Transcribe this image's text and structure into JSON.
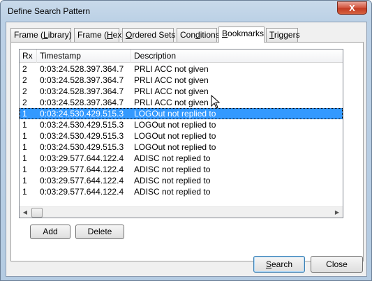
{
  "window": {
    "title": "Define Search Pattern",
    "close_glyph": "X"
  },
  "tabs": [
    {
      "pre": "Frame (",
      "ul": "L",
      "post": "ibrary)"
    },
    {
      "pre": "Frame (",
      "ul": "H",
      "post": "ex)"
    },
    {
      "pre": "",
      "ul": "O",
      "post": "rdered Sets"
    },
    {
      "pre": "Con",
      "ul": "d",
      "post": "itions"
    },
    {
      "pre": "",
      "ul": "B",
      "post": "ookmarks"
    },
    {
      "pre": "",
      "ul": "T",
      "post": "riggers"
    }
  ],
  "active_tab": 4,
  "list": {
    "columns": [
      "Rx",
      "Timestamp",
      "Description"
    ],
    "rows": [
      {
        "rx": "2",
        "timestamp": "0:03:24.528.397.364.7",
        "description": "PRLI ACC not given"
      },
      {
        "rx": "2",
        "timestamp": "0:03:24.528.397.364.7",
        "description": "PRLI ACC not given"
      },
      {
        "rx": "2",
        "timestamp": "0:03:24.528.397.364.7",
        "description": "PRLI ACC not given"
      },
      {
        "rx": "2",
        "timestamp": "0:03:24.528.397.364.7",
        "description": "PRLI ACC not given"
      },
      {
        "rx": "1",
        "timestamp": "0:03:24.530.429.515.3",
        "description": "LOGOut not replied to",
        "selected": true
      },
      {
        "rx": "1",
        "timestamp": "0:03:24.530.429.515.3",
        "description": "LOGOut not replied to"
      },
      {
        "rx": "1",
        "timestamp": "0:03:24.530.429.515.3",
        "description": "LOGOut not replied to"
      },
      {
        "rx": "1",
        "timestamp": "0:03:24.530.429.515.3",
        "description": "LOGOut not replied to"
      },
      {
        "rx": "1",
        "timestamp": "0:03:29.577.644.122.4",
        "description": "ADISC not replied to"
      },
      {
        "rx": "1",
        "timestamp": "0:03:29.577.644.122.4",
        "description": "ADISC not replied to"
      },
      {
        "rx": "1",
        "timestamp": "0:03:29.577.644.122.4",
        "description": "ADISC not replied to"
      },
      {
        "rx": "1",
        "timestamp": "0:03:29.577.644.122.4",
        "description": "ADISC not replied to"
      }
    ]
  },
  "buttons": {
    "add": "Add",
    "delete": "Delete",
    "search_ul": "S",
    "search_rest": "earch",
    "close": "Close"
  },
  "colors": {
    "selection": "#3399ff",
    "close_button": "#c9462c"
  }
}
